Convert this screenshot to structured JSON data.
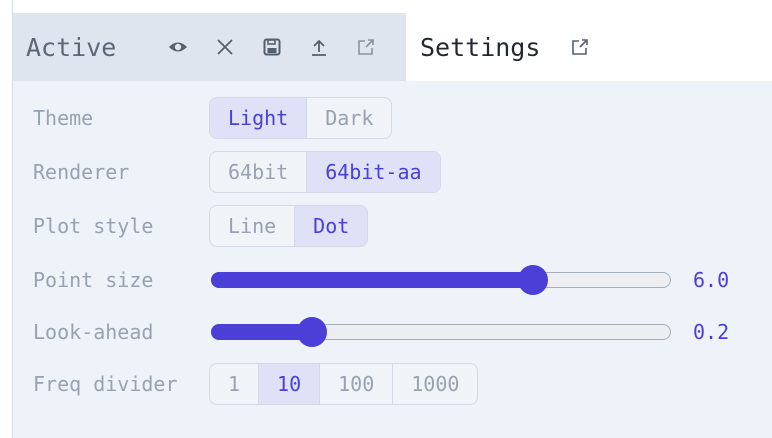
{
  "tabs": {
    "active": {
      "title": "Active",
      "icons": [
        "eye-icon",
        "close-icon",
        "save-icon",
        "upload-icon",
        "external-link-icon"
      ]
    },
    "settings": {
      "title": "Settings",
      "icons": [
        "external-link-icon"
      ]
    }
  },
  "settings": {
    "theme": {
      "label": "Theme",
      "options": [
        "Light",
        "Dark"
      ],
      "selected": "Light"
    },
    "renderer": {
      "label": "Renderer",
      "options": [
        "64bit",
        "64bit-aa"
      ],
      "selected": "64bit-aa"
    },
    "plot_style": {
      "label": "Plot style",
      "options": [
        "Line",
        "Dot"
      ],
      "selected": "Dot"
    },
    "point_size": {
      "label": "Point size",
      "value_text": "6.0",
      "fraction": 0.7
    },
    "look_ahead": {
      "label": "Look-ahead",
      "value_text": "0.2",
      "fraction": 0.22
    },
    "freq_divider": {
      "label": "Freq divider",
      "options": [
        "1",
        "10",
        "100",
        "1000"
      ],
      "selected": "10"
    }
  },
  "colors": {
    "accent": "#4b3fd8",
    "label": "#98a2b0",
    "panel": "#eef2f9",
    "selected_bg": "#dfe2f6"
  }
}
